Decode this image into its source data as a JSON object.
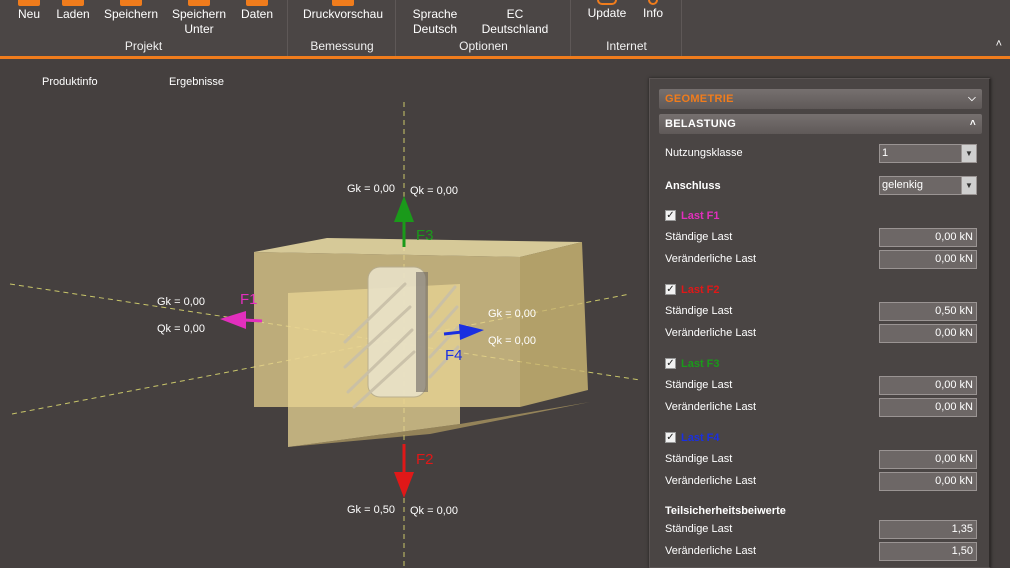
{
  "ribbon": {
    "buttons": {
      "neu": "Neu",
      "laden": "Laden",
      "speichern": "Speichern",
      "speichern_unter_1": "Speichern",
      "speichern_unter_2": "Unter",
      "daten": "Daten",
      "druckvorschau": "Druckvorschau",
      "sprache_1": "Sprache",
      "sprache_2": "Deutsch",
      "ec_1": "EC",
      "ec_2": "Deutschland",
      "update": "Update",
      "info": "Info"
    },
    "groups": {
      "projekt": "Projekt",
      "bemessung": "Bemessung",
      "optionen": "Optionen",
      "internet": "Internet"
    },
    "collapse_glyph": "˄"
  },
  "view_tabs": {
    "produktinfo": "Produktinfo",
    "ergebnisse": "Ergebnisse"
  },
  "scene": {
    "f3": {
      "name": "F3",
      "gk": "Gk = 0,00",
      "qk": "Qk = 0,00",
      "color": "#1a9a1a"
    },
    "f1": {
      "name": "F1",
      "gk": "Gk = 0,00",
      "qk": "Qk = 0,00",
      "color": "#e22fbd"
    },
    "f4": {
      "name": "F4",
      "gk": "Gk = 0,00",
      "qk": "Qk = 0,00",
      "color": "#1a2fe0"
    },
    "f2": {
      "name": "F2",
      "gk": "Gk = 0,50",
      "qk": "Qk = 0,00",
      "color": "#e01818"
    }
  },
  "panel": {
    "geometrie": "GEOMETRIE",
    "belastung": "BELASTUNG",
    "chevron_down": "⌵",
    "chevron_up": "˄",
    "nutzungsklasse_label": "Nutzungsklasse",
    "nutzungsklasse_value": "1",
    "anschluss_label": "Anschluss",
    "anschluss_value": "gelenkig",
    "select_arrow": "▼",
    "check_mark": "✓",
    "loads": [
      {
        "title": "Last F1",
        "color": "#e22fbd",
        "staendig_label": "Ständige Last",
        "staendig": "0,00 kN",
        "veraenderlich_label": "Veränderliche Last",
        "veraenderlich": "0,00 kN"
      },
      {
        "title": "Last F2",
        "color": "#e01818",
        "staendig_label": "Ständige Last",
        "staendig": "0,50 kN",
        "veraenderlich_label": "Veränderliche Last",
        "veraenderlich": "0,00 kN"
      },
      {
        "title": "Last F3",
        "color": "#1a9a1a",
        "staendig_label": "Ständige Last",
        "staendig": "0,00 kN",
        "veraenderlich_label": "Veränderliche Last",
        "veraenderlich": "0,00 kN"
      },
      {
        "title": "Last F4",
        "color": "#1a2fe0",
        "staendig_label": "Ständige Last",
        "staendig": "0,00 kN",
        "veraenderlich_label": "Veränderliche Last",
        "veraenderlich": "0,00 kN"
      }
    ],
    "teilsicherheit": {
      "title": "Teilsicherheitsbeiwerte",
      "staendig_label": "Ständige Last",
      "staendig": "1,35",
      "veraenderlich_label": "Veränderliche Last",
      "veraenderlich": "1,50"
    }
  },
  "colors": {
    "accent": "#f07c1c",
    "geometrie_text": "#f07c1c",
    "background": "#45403f"
  }
}
